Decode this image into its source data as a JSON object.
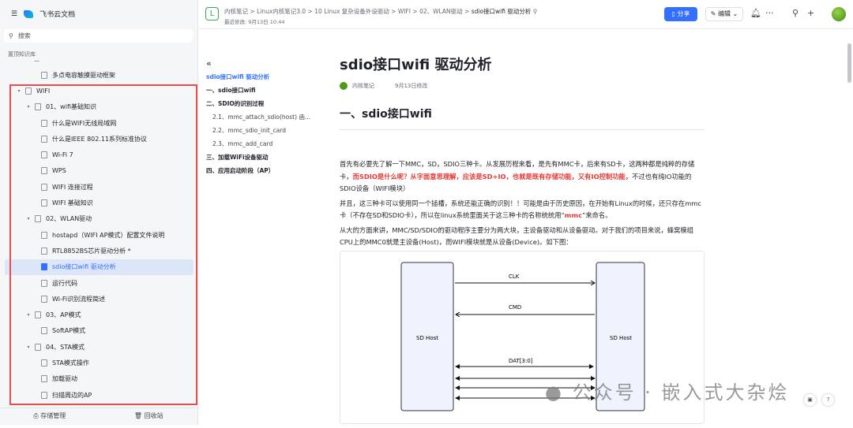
{
  "sidebar": {
    "brand": "飞书云文档",
    "search_placeholder": "搜索",
    "section": "置顶知识库",
    "dash": "—",
    "items": [
      {
        "label": "多点电容触摸驱动框架",
        "level": 2,
        "caret": false
      },
      {
        "label": "WIFI",
        "level": 0,
        "caret": true
      },
      {
        "label": "01、wifi基础知识",
        "level": 1,
        "caret": true
      },
      {
        "label": "什么是WIFI无线局域网",
        "level": 2
      },
      {
        "label": "什么是IEEE 802.11系列标准协议",
        "level": 2
      },
      {
        "label": "Wi-Fi 7",
        "level": 2
      },
      {
        "label": "WPS",
        "level": 2
      },
      {
        "label": "WIFI 连接过程",
        "level": 2
      },
      {
        "label": "WIFI 基础知识",
        "level": 2
      },
      {
        "label": "02、WLAN驱动",
        "level": 1,
        "caret": true
      },
      {
        "label": "hostapd（WIFI AP模式）配置文件说明",
        "level": 2
      },
      {
        "label": "RTL8852BS芯片驱动分析 *",
        "level": 2
      },
      {
        "label": "sdio接口wifi 驱动分析",
        "level": 2,
        "selected": true
      },
      {
        "label": "运行代码",
        "level": 2
      },
      {
        "label": "Wi-Fi识别流程简述",
        "level": 2
      },
      {
        "label": "03、AP模式",
        "level": 1,
        "caret": true
      },
      {
        "label": "SoftAP模式",
        "level": 2
      },
      {
        "label": "04、STA模式",
        "level": 1,
        "caret": true
      },
      {
        "label": "STA模式操作",
        "level": 2
      },
      {
        "label": "加载驱动",
        "level": 2
      },
      {
        "label": "扫描周边的AP",
        "level": 2
      }
    ],
    "footer": {
      "storage": "存储管理",
      "trash": "回收站"
    }
  },
  "header": {
    "badge": "L",
    "crumbs": [
      "内核笔记",
      "Linux内核笔记3.0",
      "10 Linux 复杂设备外设驱动",
      "WIFI",
      "02、WLAN驱动"
    ],
    "current": "sdio接口wifi 驱动分析",
    "modified": "最近修改: 9月13日 10:44",
    "share": "分享",
    "edit": "编辑"
  },
  "toc": {
    "collapse": "«",
    "items": [
      {
        "label": "sdio接口wifi 驱动分析",
        "cls": "act"
      },
      {
        "label": "一、sdio接口wifi",
        "cls": "b"
      },
      {
        "label": "二、SDIO的识别过程",
        "cls": "b"
      },
      {
        "label": "2.1、mmc_attach_sdio(host) 函...",
        "cls": "l2"
      },
      {
        "label": "2.2、mmc_sdio_init_card",
        "cls": "l2"
      },
      {
        "label": "2.3、mmc_add_card",
        "cls": "l2"
      },
      {
        "label": "三、加载WiFi设备驱动",
        "cls": "b"
      },
      {
        "label": "四、应用启动阶段（AP）",
        "cls": "b"
      }
    ]
  },
  "article": {
    "title": "sdio接口wifi 驱动分析",
    "author": "内核笔记",
    "date": "9月13日修改",
    "h2": "一、sdio接口wifi",
    "p1a": "首先有必要先了解一下MMC，SD，SDIO三种卡。从发展历程来看，是先有MMC卡，后来有SD卡，这两种都是纯粹的存储卡，",
    "p1b": "而SDIO是什么呢？从字面意思理解，应该是SD+IO，也就是既有存储功能，又有IO控制功能",
    "p1c": "，不过也有纯IO功能的SDIO设备（WIFI模块）",
    "p2a": "并且，这三种卡可以使用同一个插槽，系统还能正确的识别！！可能是由于历史原因，在开始有Linux的时候，还只存在mmc卡（不存在SD和SDIO卡），所以在linux系统里面关于这三种卡的名称统统用“",
    "p2b": "mmc",
    "p2c": "”来命名。",
    "p3": "从大的方面来讲，MMC/SD/SDIO的驱动程序主要分为两大块，主设备驱动和从设备驱动。对于我们的项目来说，蜂窝模组CPU上的MMC0就是主设备(Host)，而WIFI模块就是从设备(Device)。如下图："
  },
  "diagram": {
    "left": "SD Host",
    "right": "SD Host",
    "clk": "CLK",
    "cmd": "CMD",
    "dat": "DAT[3:0]"
  },
  "watermark": "公众号 · 嵌入式大杂烩"
}
